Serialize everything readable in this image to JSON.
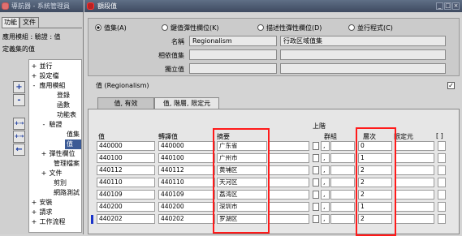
{
  "navigator": {
    "title": "導航器 - 系統管理員",
    "tabs": [
      "功能",
      "文件"
    ],
    "info_lines": [
      "應用模組 : 驗證 : 值",
      "定義集的值"
    ],
    "tree": [
      {
        "toggle": "+",
        "label": "並行"
      },
      {
        "toggle": "+",
        "label": "設定檔"
      },
      {
        "toggle": "-",
        "label": "應用模組"
      },
      {
        "toggle": "",
        "label": "登錄"
      },
      {
        "toggle": "",
        "label": "函數"
      },
      {
        "toggle": "",
        "label": "功能表"
      },
      {
        "toggle": "-",
        "label": "驗證"
      },
      {
        "toggle": "",
        "label": "值集"
      },
      {
        "toggle": "",
        "label": "值"
      },
      {
        "toggle": "+",
        "label": "彈性欄位"
      },
      {
        "toggle": "",
        "label": "管理檔案"
      },
      {
        "toggle": "+",
        "label": "文件"
      },
      {
        "toggle": "",
        "label": "剪別"
      },
      {
        "toggle": "",
        "label": "網路測試"
      },
      {
        "toggle": "+",
        "label": "安裝"
      },
      {
        "toggle": "+",
        "label": "請求"
      },
      {
        "toggle": "+",
        "label": "工作流程"
      }
    ],
    "side_buttons": [
      "+",
      "-",
      "+→",
      "+→",
      "←"
    ]
  },
  "window": {
    "title": "額段值",
    "buttons": [
      "_",
      "□",
      "×"
    ]
  },
  "find_by": {
    "options": [
      "值集(A)",
      "鍵值彈性欄位(K)",
      "描述性彈性欄位(D)",
      "並行程式(C)"
    ],
    "selected": 0
  },
  "value_set": {
    "labels": [
      "名稱",
      "相依值集",
      "獨立值"
    ],
    "name": "Regionalism",
    "description": "行政区域值集",
    "dependent": "",
    "independent": ""
  },
  "section": {
    "title": "值 (Regionalism)",
    "checkbox": "✓"
  },
  "tabs": [
    "值, 有效",
    "值, 階層, 限定元"
  ],
  "active_tab": 1,
  "columns": {
    "value": "值",
    "translated": "轉譯值",
    "description": "摘要",
    "parent_top": "上階",
    "group": "群組",
    "level": "層次",
    "qualifier": "限定元",
    "bracket": "[ ]"
  },
  "rows": [
    {
      "value": "440000",
      "translated": "440000",
      "description": "广东省",
      "level": "0"
    },
    {
      "value": "440100",
      "translated": "440100",
      "description": "广州市",
      "level": "1"
    },
    {
      "value": "440112",
      "translated": "440112",
      "description": "黄埔区",
      "level": "2"
    },
    {
      "value": "440110",
      "translated": "440110",
      "description": "天河区",
      "level": "2"
    },
    {
      "value": "440109",
      "translated": "440109",
      "description": "荔湾区",
      "level": "2"
    },
    {
      "value": "440200",
      "translated": "440200",
      "description": "深圳市",
      "level": "1"
    },
    {
      "value": "440202",
      "translated": "440202",
      "description": "罗湖区",
      "level": "2"
    }
  ],
  "highlight_color": "#ff1a1a"
}
